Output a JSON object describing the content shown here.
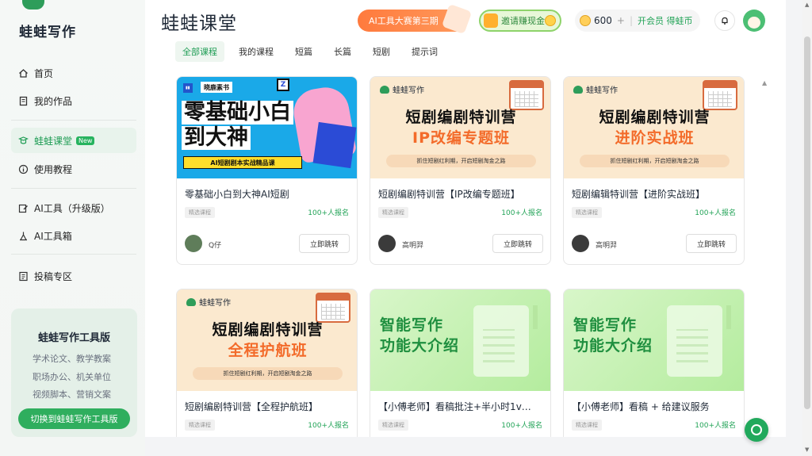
{
  "app": {
    "name": "蛙蛙写作"
  },
  "sidebar": {
    "items": [
      {
        "label": "首页",
        "icon": "home-icon"
      },
      {
        "label": "我的作品",
        "icon": "document-icon"
      },
      {
        "label": "蛙蛙课堂",
        "icon": "course-icon",
        "badge": "New",
        "active": true
      },
      {
        "label": "使用教程",
        "icon": "info-icon"
      },
      {
        "label": "AI工具（升级版）",
        "icon": "edit-icon"
      },
      {
        "label": "AI工具箱",
        "icon": "toolbox-icon"
      },
      {
        "label": "投稿专区",
        "icon": "submit-icon"
      }
    ],
    "promo": {
      "title": "蛙蛙写作工具版",
      "lines": [
        "学术论文、教学教案",
        "职场办公、机关单位",
        "视频脚本、营销文案"
      ],
      "button": "切换到蛙蛙写作工具版"
    }
  },
  "header": {
    "title": "蛙蛙课堂",
    "event_pill": "AI工具大赛第三期",
    "invite_pill": "邀请赚现金",
    "coins": "600",
    "vip_link": "开会员 得蛙币"
  },
  "tabs": [
    {
      "label": "全部课程",
      "active": true
    },
    {
      "label": "我的课程"
    },
    {
      "label": "短篇"
    },
    {
      "label": "长篇"
    },
    {
      "label": "短剧"
    },
    {
      "label": "提示词"
    }
  ],
  "courses": [
    {
      "title": "零基础小白到大神AI短剧",
      "tag": "精选课程",
      "count": "100+人报名",
      "author": "Q仔",
      "button": "立即跳转",
      "thumb": {
        "style": "blue",
        "brand": "晓鹿素书",
        "line1": "零基础小白",
        "line2": "到大神",
        "ribbon": "AI短剧剧本实战精品课"
      }
    },
    {
      "title": "短剧编剧特训营【IP改编专题班】",
      "tag": "精选课程",
      "count": "100+人报名",
      "author": "高明羿",
      "button": "立即跳转",
      "thumb": {
        "style": "cream",
        "brand": "蛙蛙写作",
        "line1": "短剧编剧特训营",
        "line2": "IP改编专题班",
        "ribbon": "抓住短剧红利期，开启短剧淘金之路"
      }
    },
    {
      "title": "短剧编辑特训营【进阶实战班】",
      "tag": "精选课程",
      "count": "100+人报名",
      "author": "高明羿",
      "button": "立即跳转",
      "thumb": {
        "style": "cream",
        "brand": "蛙蛙写作",
        "line1": "短剧编剧特训营",
        "line2": "进阶实战班",
        "ribbon": "抓住短剧红利期，开启短剧淘金之路"
      }
    },
    {
      "title": "短剧编剧特训营【全程护航班】",
      "tag": "精选课程",
      "count": "100+人报名",
      "thumb": {
        "style": "cream",
        "brand": "蛙蛙写作",
        "line1": "短剧编剧特训营",
        "line2": "全程护航班",
        "ribbon": "抓住短剧红利期，开启短剧淘金之路"
      }
    },
    {
      "title": "【小傅老师】看稿批注+半小时1v…",
      "tag": "精选课程",
      "count": "100+人报名",
      "thumb": {
        "style": "green",
        "line1": "智能写作",
        "line2": "功能大介绍"
      }
    },
    {
      "title": "【小傅老师】看稿 + 给建议服务",
      "tag": "精选课程",
      "count": "100+人报名",
      "thumb": {
        "style": "green",
        "line1": "智能写作",
        "line2": "功能大介绍"
      }
    }
  ],
  "colors": {
    "accent": "#22a357",
    "orange": "#ff7a3d"
  }
}
